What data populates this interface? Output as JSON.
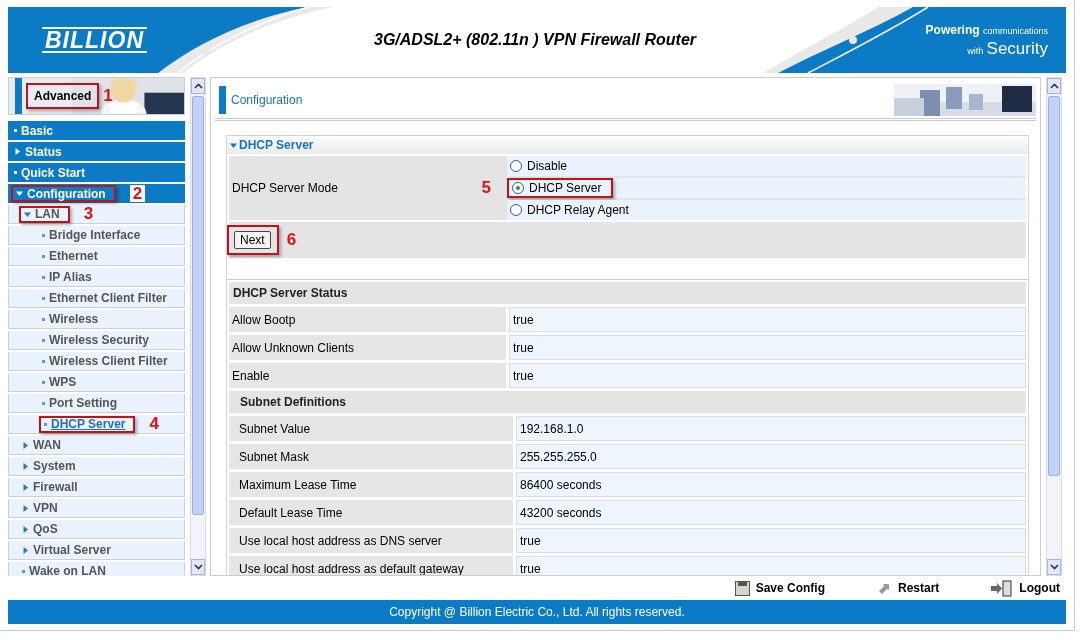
{
  "header": {
    "brand": "BILLION",
    "title": "3G/ADSL2+ (802.11n ) VPN Firewall Router",
    "tagline_lead": "Powering",
    "tagline_small": "communications",
    "tagline_with": "with",
    "tagline_main": "Security"
  },
  "sidebar": {
    "mode": {
      "label": "Advanced",
      "callout": "1"
    },
    "items": [
      {
        "label": "Basic",
        "kind": "leaf",
        "selected": false
      },
      {
        "label": "Status",
        "kind": "group",
        "expanded": false,
        "selected": false
      },
      {
        "label": "Quick Start",
        "kind": "leaf",
        "selected": false
      },
      {
        "label": "Configuration",
        "kind": "group",
        "expanded": true,
        "selected": false,
        "callout": "2",
        "children": [
          {
            "label": "LAN",
            "kind": "group",
            "expanded": true,
            "selected": false,
            "callout": "3",
            "children": [
              {
                "label": "Bridge Interface",
                "kind": "leaf",
                "selected": false
              },
              {
                "label": "Ethernet",
                "kind": "leaf",
                "selected": false
              },
              {
                "label": "IP Alias",
                "kind": "leaf",
                "selected": false
              },
              {
                "label": "Ethernet Client Filter",
                "kind": "leaf",
                "selected": false
              },
              {
                "label": "Wireless",
                "kind": "leaf",
                "selected": false
              },
              {
                "label": "Wireless Security",
                "kind": "leaf",
                "selected": false
              },
              {
                "label": "Wireless Client Filter",
                "kind": "leaf",
                "selected": false
              },
              {
                "label": "WPS",
                "kind": "leaf",
                "selected": false
              },
              {
                "label": "Port Setting",
                "kind": "leaf",
                "selected": false
              },
              {
                "label": "DHCP Server",
                "kind": "leaf",
                "selected": true,
                "callout": "4"
              }
            ]
          },
          {
            "label": "WAN",
            "kind": "group",
            "expanded": false,
            "selected": false
          },
          {
            "label": "System",
            "kind": "group",
            "expanded": false,
            "selected": false
          },
          {
            "label": "Firewall",
            "kind": "group",
            "expanded": false,
            "selected": false
          },
          {
            "label": "VPN",
            "kind": "group",
            "expanded": false,
            "selected": false
          },
          {
            "label": "QoS",
            "kind": "group",
            "expanded": false,
            "selected": false
          },
          {
            "label": "Virtual Server",
            "kind": "group",
            "expanded": false,
            "selected": false
          },
          {
            "label": "Wake on LAN",
            "kind": "leaf",
            "selected": false
          }
        ]
      }
    ]
  },
  "panel": {
    "title": "Configuration"
  },
  "section": {
    "title": "DHCP Server",
    "expanded": true,
    "mode_label": "DHCP Server Mode",
    "options": [
      {
        "label": "Disable",
        "selected": false
      },
      {
        "label": "DHCP Server",
        "selected": true,
        "callout": "5"
      },
      {
        "label": "DHCP Relay Agent",
        "selected": false
      }
    ],
    "next_button": {
      "label": "Next",
      "callout": "6"
    }
  },
  "status_table": [
    {
      "kind": "heading",
      "label": "DHCP Server Status"
    },
    {
      "kind": "row",
      "label": "Allow Bootp",
      "value": "true"
    },
    {
      "kind": "row",
      "label": "Allow Unknown Clients",
      "value": "true"
    },
    {
      "kind": "row",
      "label": "Enable",
      "value": "true"
    },
    {
      "kind": "subheading",
      "label": "Subnet Definitions"
    },
    {
      "kind": "subrow",
      "label": "Subnet Value",
      "value": "192.168.1.0"
    },
    {
      "kind": "subrow",
      "label": "Subnet Mask",
      "value": "255.255.255.0"
    },
    {
      "kind": "subrow",
      "label": "Maximum Lease Time",
      "value": "86400 seconds"
    },
    {
      "kind": "subrow",
      "label": "Default Lease Time",
      "value": "43200 seconds"
    },
    {
      "kind": "subrow",
      "label": "Use local host address as DNS server",
      "value": "true"
    },
    {
      "kind": "subrow",
      "label": "Use local host address as default gateway",
      "value": "true"
    }
  ],
  "toolbar": [
    {
      "kind": "save",
      "label": "Save Config"
    },
    {
      "kind": "restart",
      "label": "Restart"
    },
    {
      "kind": "logout",
      "label": "Logout"
    }
  ],
  "footer": "Copyright @ Billion Electric Co., Ltd. All rights reserved."
}
